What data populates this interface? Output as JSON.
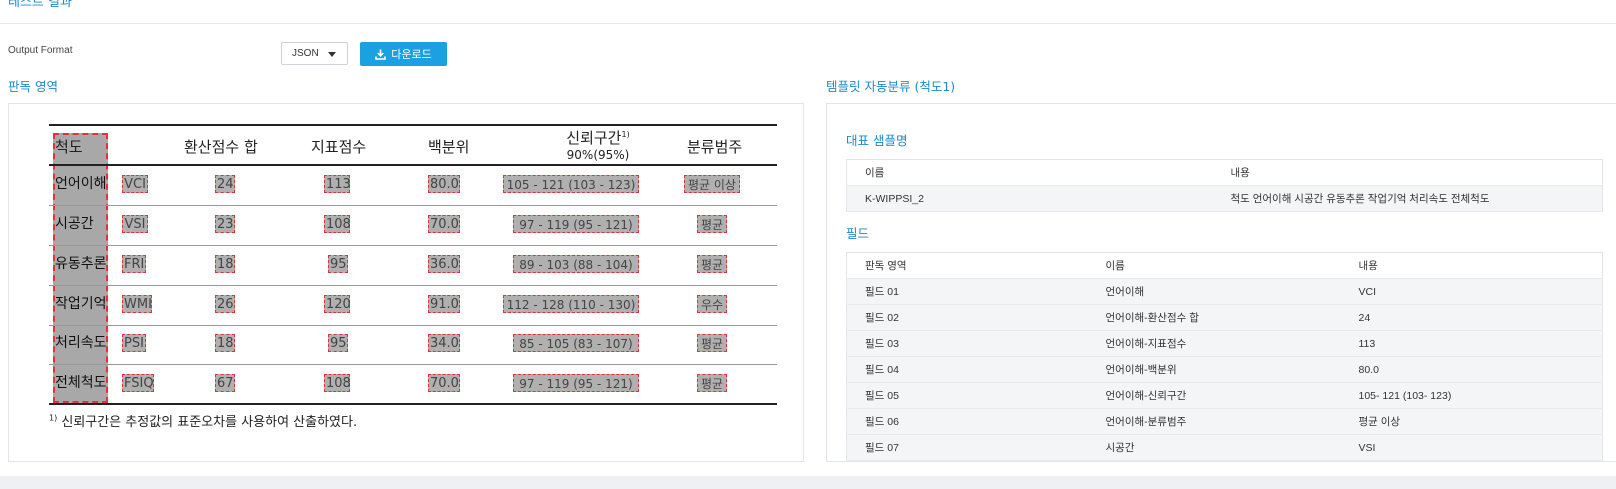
{
  "section": {
    "title": "테스트 결과"
  },
  "output": {
    "label": "Output Format",
    "format_value": "JSON",
    "download_label": "다운로드"
  },
  "left_panel": {
    "title": "판독 영역",
    "document": {
      "headers": {
        "scale": "척도",
        "sum": "환산점수 합",
        "index": "지표점수",
        "percentile": "백분위",
        "ci": "신뢰구간",
        "ci_sup": "1)",
        "ci_sub": "90%(95%)",
        "category": "분류범주"
      },
      "rows": [
        {
          "scale": "언어이해",
          "code": "VCI",
          "sum": "24",
          "index": "113",
          "pct": "80.0",
          "ci": "105 - 121 (103 - 123)",
          "cat": "평균 이상"
        },
        {
          "scale": "시공간",
          "code": "VSI",
          "sum": "23",
          "index": "108",
          "pct": "70.0",
          "ci": "97 - 119 (95 - 121)",
          "cat": "평균"
        },
        {
          "scale": "유동추론",
          "code": "FRI",
          "sum": "18",
          "index": "95",
          "pct": "36.0",
          "ci": "89 - 103 (88 - 104)",
          "cat": "평균"
        },
        {
          "scale": "작업기억",
          "code": "WMI",
          "sum": "26",
          "index": "120",
          "pct": "91.0",
          "ci": "112 - 128 (110 - 130)",
          "cat": "우수"
        },
        {
          "scale": "처리속도",
          "code": "PSI",
          "sum": "18",
          "index": "95",
          "pct": "34.0",
          "ci": "85 - 105 (83 - 107)",
          "cat": "평균"
        },
        {
          "scale": "전체척도",
          "code": "FSIQ",
          "sum": "67",
          "index": "108",
          "pct": "70.0",
          "ci": "97 - 119 (95 - 121)",
          "cat": "평균"
        }
      ],
      "note_sup": "1)",
      "note": "신뢰구간은 추정값의 표준오차를 사용하여 산출하였다."
    }
  },
  "right_panel": {
    "title": "템플릿 자동분류 (척도1)",
    "representative": {
      "title": "대표 샘플명",
      "headers": {
        "name": "이름",
        "content": "내용"
      },
      "row": {
        "name": "K-WIPPSI_2",
        "content": "척도 언어이해 시공간 유동추론 작업기억 처리속도 전체척도"
      }
    },
    "fields": {
      "title": "필드",
      "headers": {
        "area": "판독 영역",
        "name": "이름",
        "content": "내용"
      },
      "rows": [
        {
          "area": "필드 01",
          "name": "언어이해",
          "content": "VCI"
        },
        {
          "area": "필드 02",
          "name": "언어이해-환산점수 합",
          "content": "24"
        },
        {
          "area": "필드 03",
          "name": "언어이해-지표점수",
          "content": "113"
        },
        {
          "area": "필드 04",
          "name": "언어이해-백분위",
          "content": "80.0"
        },
        {
          "area": "필드 05",
          "name": "언어이해-신뢰구간",
          "content": "105- 121 (103- 123)"
        },
        {
          "area": "필드 06",
          "name": "언어이해-분류범주",
          "content": "평균 이상"
        },
        {
          "area": "필드 07",
          "name": "시공간",
          "content": "VSI"
        }
      ]
    }
  }
}
